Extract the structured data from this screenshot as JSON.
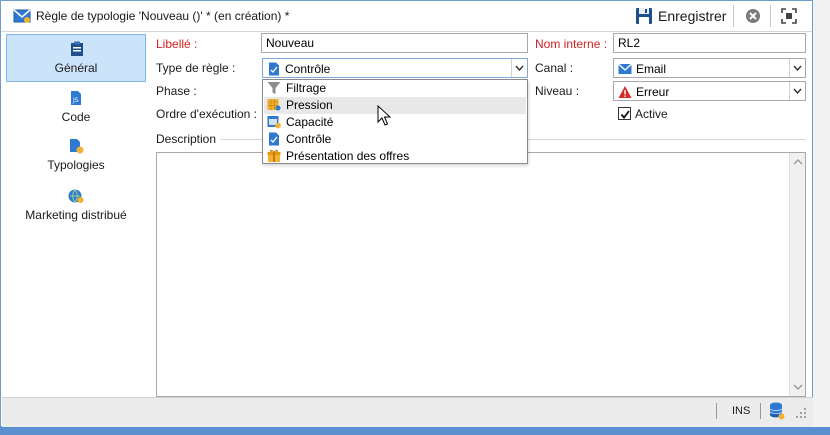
{
  "window": {
    "title": "Règle de typologie 'Nouveau ()' * (en création) *"
  },
  "toolbar": {
    "save_label": "Enregistrer"
  },
  "sidebar": {
    "items": [
      {
        "label": "Général",
        "icon": "clipboard-icon",
        "active": true
      },
      {
        "label": "Code",
        "icon": "code-file-icon",
        "active": false
      },
      {
        "label": "Typologies",
        "icon": "typology-icon",
        "active": false
      },
      {
        "label": "Marketing distribué",
        "icon": "globe-user-icon",
        "active": false
      }
    ]
  },
  "form": {
    "libelle_label": "Libellé :",
    "libelle_value": "Nouveau",
    "nom_interne_label": "Nom interne :",
    "nom_interne_value": "RL2",
    "type_regle_label": "Type de règle :",
    "type_regle_value": "Contrôle",
    "canal_label": "Canal :",
    "canal_value": "Email",
    "phase_label": "Phase :",
    "niveau_label": "Niveau :",
    "niveau_value": "Erreur",
    "ordre_label": "Ordre d'exécution :",
    "active_label": "Active",
    "active_checked": true,
    "description_label": "Description"
  },
  "dropdown": {
    "options": [
      {
        "label": "Filtrage",
        "icon": "funnel-icon"
      },
      {
        "label": "Pression",
        "icon": "calendar-user-icon",
        "hovered": true
      },
      {
        "label": "Capacité",
        "icon": "calendar-gear-icon"
      },
      {
        "label": "Contrôle",
        "icon": "document-check-icon"
      },
      {
        "label": "Présentation des offres",
        "icon": "gift-icon"
      }
    ]
  },
  "statusbar": {
    "ins_label": "INS"
  },
  "colors": {
    "required_label": "#d21f1f",
    "active_tab_bg": "#cce4fa",
    "accent_blue": "#1f6fc8",
    "error_red": "#d32a2a"
  }
}
